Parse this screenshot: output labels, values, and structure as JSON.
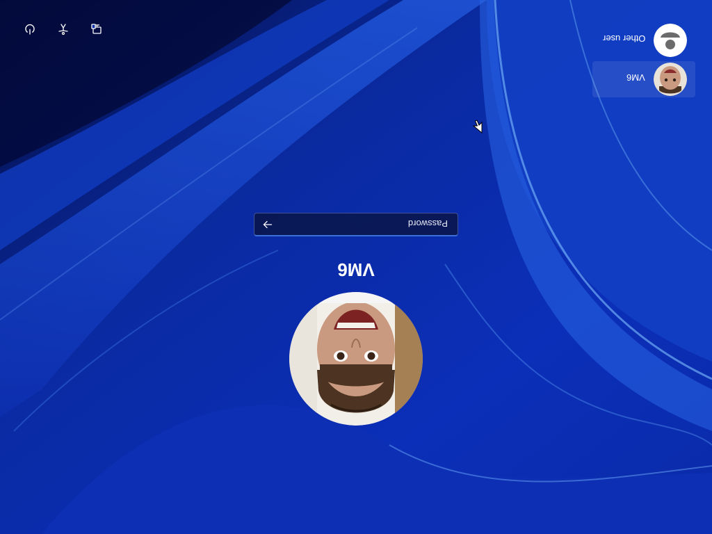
{
  "selected_user": {
    "name": "VM6"
  },
  "password": {
    "placeholder": "Password",
    "value": ""
  },
  "user_list": [
    {
      "name": "Other user",
      "selected": false,
      "avatar": "generic-user-icon"
    },
    {
      "name": "VM6",
      "selected": true,
      "avatar": "user-photo"
    }
  ],
  "system_buttons": [
    {
      "icon": "power-icon"
    },
    {
      "icon": "accessibility-icon"
    },
    {
      "icon": "network-icon"
    }
  ],
  "colors": {
    "background": "#0a2ba8",
    "accent": "#3c6fd8"
  },
  "orientation": "rotated-180"
}
